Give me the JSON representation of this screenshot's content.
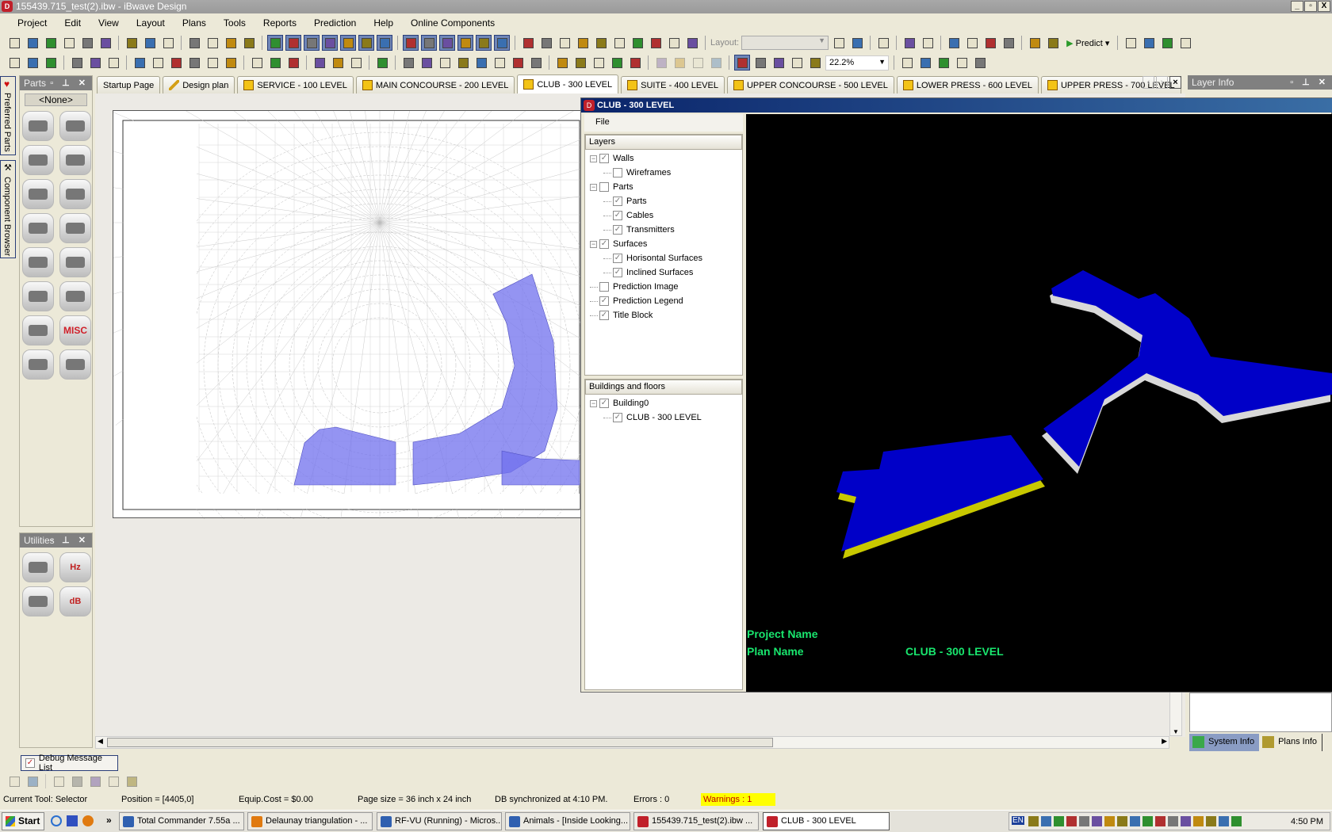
{
  "window": {
    "title": "155439.715_test(2).ibw - iBwave Design",
    "app_icon": "iBwave",
    "min": "_",
    "max": "▫",
    "close": "X"
  },
  "menu": [
    "Project",
    "Edit",
    "View",
    "Layout",
    "Plans",
    "Tools",
    "Reports",
    "Prediction",
    "Help",
    "Online Components"
  ],
  "toolbar1": {
    "layout_label": "Layout:",
    "layout_value": "",
    "predict_label": "Predict",
    "icons": [
      "new-file",
      "open-folder",
      "open-lock",
      "save",
      "print-preview",
      "print",
      "sep",
      "properties",
      "undo",
      "redo",
      "sep",
      "cut",
      "copy",
      "paste",
      "delete",
      "sep",
      "hl:filter",
      "hl:floor",
      "hl:parts",
      "hl:plans",
      "hl:antenna",
      "hl:transmitter",
      "hl:checklist",
      "sep",
      "hl:tools",
      "hl:tower",
      "hl:favorite",
      "hl:bill",
      "hl:cursor-tool",
      "hl:layers",
      "sep",
      "cart",
      "report",
      "mirror",
      "x-parts",
      "y-parts",
      "x-chart",
      "y-chart",
      "user-parts",
      "radiation",
      "pdf"
    ]
  },
  "toolbar1_right": {
    "icons": [
      "3d-box",
      "3d-cube",
      "sep",
      "list",
      "sep",
      "phone-add",
      "phone-remove",
      "sep",
      "wall",
      "wall-type",
      "eraser",
      "floor-grid",
      "sep",
      "report-view",
      "heatmap"
    ],
    "icons2": [
      "crop",
      "line-measure",
      "grid-target",
      "move-cross"
    ]
  },
  "toolbar2": {
    "icons": [
      "align-left",
      "align-center",
      "align-right",
      "sep",
      "align-top",
      "align-middle",
      "align-bottom",
      "sep",
      "bring-front",
      "send-back",
      "group",
      "ungroup",
      "frame",
      "unframe",
      "sep",
      "text-left",
      "text-center",
      "text-right",
      "sep",
      "valign-top",
      "valign-mid",
      "valign-bot",
      "sep",
      "route",
      "sep",
      "table",
      "paint",
      "legend",
      "building",
      "floor-image",
      "bar-red",
      "bar-orange",
      "bar-yellow",
      "sep",
      "line",
      "rectangle",
      "polygon",
      "text-box",
      "picture",
      "sep",
      "disabled-1",
      "disabled-2",
      "disabled-3",
      "disabled-4",
      "sep",
      "hl:pointer",
      "stamp",
      "hand-pan",
      "zoom",
      "zoom-window"
    ],
    "zoom": "22.2%",
    "icons_after": [
      "ruler",
      "fit-grid",
      "globe",
      "z-tool",
      "pin"
    ]
  },
  "tabs": [
    {
      "label": "Startup Page",
      "icon": "none"
    },
    {
      "label": "Design plan",
      "icon": "pen"
    },
    {
      "label": "SERVICE - 100 LEVEL",
      "icon": "plan"
    },
    {
      "label": "MAIN CONCOURSE - 200 LEVEL",
      "icon": "plan"
    },
    {
      "label": "CLUB - 300 LEVEL",
      "icon": "plan",
      "active": true
    },
    {
      "label": "SUITE - 400 LEVEL",
      "icon": "plan"
    },
    {
      "label": "UPPER CONCOURSE - 500 LEVEL",
      "icon": "plan"
    },
    {
      "label": "LOWER PRESS - 600 LEVEL",
      "icon": "plan"
    },
    {
      "label": "UPPER PRESS - 700 LEVEL",
      "icon": "plan"
    }
  ],
  "side_tabs": {
    "preferred": "Preferred Parts",
    "component": "Component Browser"
  },
  "parts_panel": {
    "title": "Parts",
    "filter": "<None>",
    "items": [
      "coax-cable",
      "antenna",
      "amplifier",
      "repeater",
      "radiator",
      "connectors",
      "load",
      "splitter",
      "combiner",
      "coupler",
      "attenuator-module",
      "remote-unit",
      "access-point",
      "misc",
      "jumper",
      "remove-antenna"
    ],
    "misc_label": "MISC"
  },
  "utilities_panel": {
    "title": "Utilities",
    "items": [
      "calculator",
      "frequency",
      "spectrum",
      "db-converter"
    ],
    "hz_label": "Hz",
    "db_label": "dB"
  },
  "plan_window": {
    "title": "CLUB - 300 LEVEL",
    "file_menu": "File",
    "layers_header": "Layers",
    "layers": [
      {
        "label": "Walls",
        "depth": 0,
        "checked": true,
        "expander": true
      },
      {
        "label": "Wireframes",
        "depth": 1,
        "checked": false
      },
      {
        "label": "Parts",
        "depth": 0,
        "checked": false,
        "expander": true
      },
      {
        "label": "Parts",
        "depth": 1,
        "checked": true
      },
      {
        "label": "Cables",
        "depth": 1,
        "checked": true
      },
      {
        "label": "Transmitters",
        "depth": 1,
        "checked": true
      },
      {
        "label": "Surfaces",
        "depth": 0,
        "checked": true,
        "expander": true
      },
      {
        "label": "Horisontal Surfaces",
        "depth": 1,
        "checked": true
      },
      {
        "label": "Inclined Surfaces",
        "depth": 1,
        "checked": true
      },
      {
        "label": "Prediction Image",
        "depth": 0,
        "checked": false
      },
      {
        "label": "Prediction Legend",
        "depth": 0,
        "checked": true
      },
      {
        "label": "Title Block",
        "depth": 0,
        "checked": true
      }
    ],
    "buildings_header": "Buildings and floors",
    "buildings": [
      {
        "label": "Building0",
        "depth": 0,
        "checked": true,
        "expander": true
      },
      {
        "label": "CLUB - 300 LEVEL",
        "depth": 1,
        "checked": true
      }
    ],
    "title_block": {
      "project_label": "Project Name",
      "plan_label": "Plan Name",
      "plan_value": "CLUB - 300 LEVEL"
    },
    "colors": {
      "floor": "#0000c8",
      "edge_left": "#c8c800",
      "edge_right": "#d8d8d8",
      "text": "#19e66e"
    }
  },
  "layer_info": {
    "title": "Layer Info"
  },
  "info_tabs": [
    {
      "label": "System Info",
      "active": true
    },
    {
      "label": "Plans Info"
    }
  ],
  "debug": {
    "label": "Debug Message List"
  },
  "status": {
    "tool": "Current Tool: Selector",
    "position": "Position = [4405,0]",
    "cost": "Equip.Cost = $0.00",
    "page": "Page size = 36 inch x 24 inch",
    "db": "DB synchronized at 4:10 PM.",
    "errors": "Errors : 0",
    "warnings": "Warnings : 1"
  },
  "taskbar": {
    "start": "Start",
    "more": "»",
    "tasks": [
      {
        "label": "Total Commander 7.55a ..."
      },
      {
        "label": "Delaunay triangulation - ..."
      },
      {
        "label": "RF-VU (Running) - Micros..."
      },
      {
        "label": "Animals - [Inside Looking..."
      },
      {
        "label": "155439.715_test(2).ibw ..."
      },
      {
        "label": "CLUB - 300 LEVEL",
        "active": true
      }
    ],
    "clock": "4:50 PM",
    "lang": "EN"
  }
}
